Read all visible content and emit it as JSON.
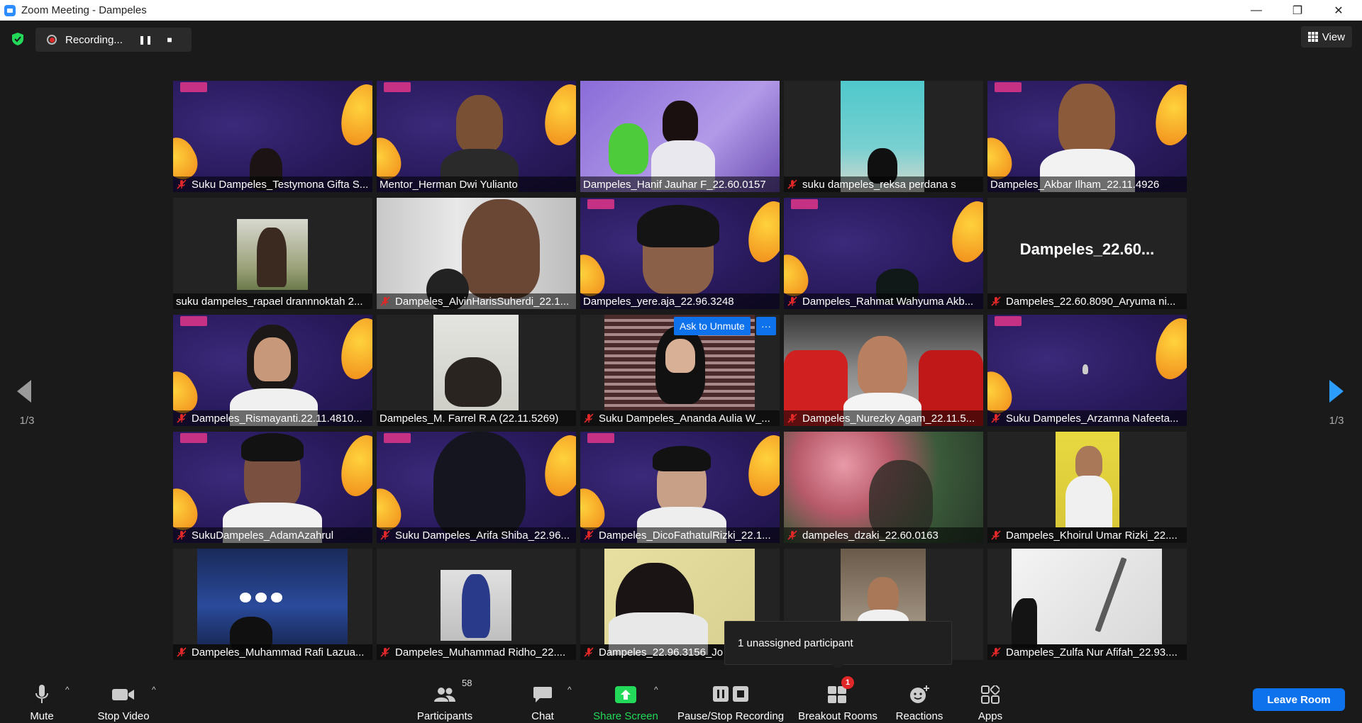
{
  "window": {
    "title": "Zoom Meeting - Dampeles",
    "min": "—",
    "restore": "❐",
    "close": "✕"
  },
  "recording": {
    "text": "Recording...",
    "pause": "❚❚",
    "stop": "■"
  },
  "view_label": "View",
  "page_indicator_left": "1/3",
  "page_indicator_right": "1/3",
  "tiles": [
    {
      "name": "Suku Dampeles_Testymona Gifta S...",
      "muted": true
    },
    {
      "name": "Mentor_Herman Dwi Yulianto",
      "muted": false,
      "active": true
    },
    {
      "name": "Dampeles_Hanif Jauhar F_22.60.0157",
      "muted": false
    },
    {
      "name": "suku dampeles_reksa perdana s",
      "muted": true
    },
    {
      "name": "Dampeles_Akbar Ilham_22.11.4926",
      "muted": false
    },
    {
      "name": "suku dampeles_rapael drannnoktah 2...",
      "muted": false
    },
    {
      "name": "Dampeles_AlvinHarisSuherdi_22.1...",
      "muted": true
    },
    {
      "name": "Dampeles_yere.aja_22.96.3248",
      "muted": false
    },
    {
      "name": "Dampeles_Rahmat Wahyuma Akb...",
      "muted": true
    },
    {
      "name": "Dampeles_22.60.8090_Aryuma ni...",
      "muted": true,
      "big": "Dampeles_22.60..."
    },
    {
      "name": "Dampeles_Rismayanti.22.11.4810...",
      "muted": true
    },
    {
      "name": "Dampeles_M. Farrel R.A (22.11.5269)",
      "muted": false
    },
    {
      "name": "Suku Dampeles_Ananda Aulia W_...",
      "muted": true
    },
    {
      "name": "Dampeles_Nurezky Agam_22.11.5...",
      "muted": true
    },
    {
      "name": "Suku Dampeles_Arzamna Nafeeta...",
      "muted": true
    },
    {
      "name": "SukuDampeles_AdamAzahrul",
      "muted": true
    },
    {
      "name": "Suku Dampeles_Arifa Shiba_22.96...",
      "muted": true
    },
    {
      "name": "Dampeles_DicoFathatulRizki_22.1...",
      "muted": true
    },
    {
      "name": "dampeles_dzaki_22.60.0163",
      "muted": true
    },
    {
      "name": "Dampeles_Khoirul Umar Rizki_22....",
      "muted": true
    },
    {
      "name": "Dampeles_Muhammad Rafi Lazua...",
      "muted": true
    },
    {
      "name": "Dampeles_Muhammad Ridho_22....",
      "muted": true
    },
    {
      "name": "Dampeles_22.96.3156_Jo",
      "muted": true
    },
    {
      "name": "",
      "muted": false
    },
    {
      "name": "Dampeles_Zulfa Nur Afifah_22.93....",
      "muted": true
    }
  ],
  "ask_to_unmute": "Ask to Unmute",
  "more_dots": "···",
  "tooltip": "1 unassigned participant",
  "toolbar": {
    "mute": "Mute",
    "stop_video": "Stop Video",
    "participants": "Participants",
    "participants_count": "58",
    "chat": "Chat",
    "share_screen": "Share Screen",
    "pause_stop_recording": "Pause/Stop Recording",
    "breakout_rooms": "Breakout Rooms",
    "breakout_badge": "1",
    "reactions": "Reactions",
    "apps": "Apps",
    "leave_room": "Leave Room",
    "caret": "^"
  },
  "colors": {
    "accent_blue": "#0e72ed",
    "share_green": "#23d959",
    "active_speaker": "#e8e86a",
    "muted_red": "#e02828"
  }
}
